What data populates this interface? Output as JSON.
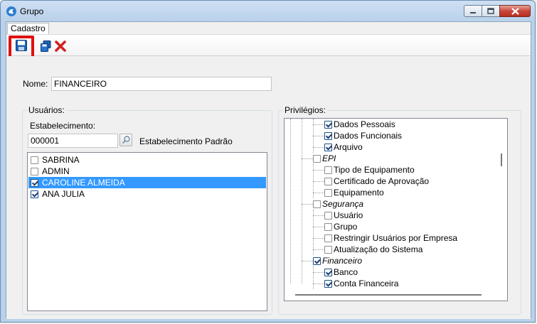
{
  "window": {
    "title": "Grupo"
  },
  "tabs": [
    {
      "label": "Cadastro"
    }
  ],
  "toolbar": {
    "save_icon": "save-icon",
    "copy_icon": "copy-icon",
    "delete_icon": "delete-icon"
  },
  "form": {
    "nome_label": "Nome:",
    "nome_value": "FINANCEIRO"
  },
  "usuarios": {
    "group_title": "Usuários:",
    "estabelecimento_label": "Estabelecimento:",
    "estabelecimento_value": "000001",
    "estabelecimento_name": "Estabelecimento Padrão",
    "items": [
      {
        "label": "SABRINA",
        "checked": false,
        "selected": false
      },
      {
        "label": "ADMIN",
        "checked": false,
        "selected": false
      },
      {
        "label": "CAROLINE ALMEIDA",
        "checked": true,
        "selected": true
      },
      {
        "label": "ANA JULIA",
        "checked": true,
        "selected": false
      }
    ]
  },
  "privilegios": {
    "group_title": "Privilégios:",
    "nodes": [
      {
        "label": "Dados Pessoais",
        "checked": true,
        "level": 2,
        "italic": false
      },
      {
        "label": "Dados Funcionais",
        "checked": true,
        "level": 2,
        "italic": false
      },
      {
        "label": "Arquivo",
        "checked": true,
        "level": 2,
        "italic": false
      },
      {
        "label": "EPI",
        "checked": false,
        "level": 1,
        "italic": true
      },
      {
        "label": "Tipo de Equipamento",
        "checked": false,
        "level": 2,
        "italic": false
      },
      {
        "label": "Certificado de Aprovação",
        "checked": false,
        "level": 2,
        "italic": false
      },
      {
        "label": "Equipamento",
        "checked": false,
        "level": 2,
        "italic": false
      },
      {
        "label": "Segurança",
        "checked": false,
        "level": 1,
        "italic": true
      },
      {
        "label": "Usuário",
        "checked": false,
        "level": 2,
        "italic": false
      },
      {
        "label": "Grupo",
        "checked": false,
        "level": 2,
        "italic": false
      },
      {
        "label": "Restringir Usuários por Empresa",
        "checked": false,
        "level": 2,
        "italic": false
      },
      {
        "label": "Atualização do Sistema",
        "checked": false,
        "level": 2,
        "italic": false
      },
      {
        "label": "Financeiro",
        "checked": true,
        "level": 1,
        "italic": true
      },
      {
        "label": "Banco",
        "checked": true,
        "level": 2,
        "italic": false
      },
      {
        "label": "Conta Financeira",
        "checked": true,
        "level": 2,
        "italic": false
      }
    ]
  },
  "colors": {
    "selection": "#3399ff",
    "highlight_border": "#e01010",
    "delete_red": "#d42020"
  }
}
